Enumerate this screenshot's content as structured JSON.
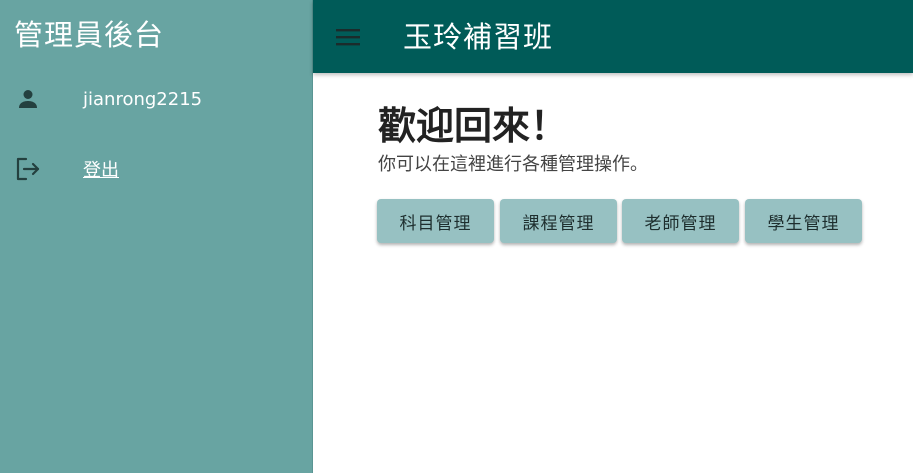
{
  "sidebar": {
    "title": "管理員後台",
    "user": {
      "icon": "person-icon",
      "name": "jianrong2215"
    },
    "logout": {
      "icon": "logout-icon",
      "label": "登出"
    }
  },
  "topbar": {
    "menu_icon": "hamburger-menu-icon",
    "title": "玉玲補習班"
  },
  "main": {
    "heading": "歡迎回來！",
    "subtitle": "你可以在這裡進行各種管理操作。",
    "buttons": [
      {
        "label": "科目管理"
      },
      {
        "label": "課程管理"
      },
      {
        "label": "老師管理"
      },
      {
        "label": "學生管理"
      }
    ]
  },
  "colors": {
    "sidebar_bg": "#68a4a2",
    "topbar_bg": "#005b58",
    "button_bg": "#97c1c2",
    "heading_text": "#222222"
  }
}
